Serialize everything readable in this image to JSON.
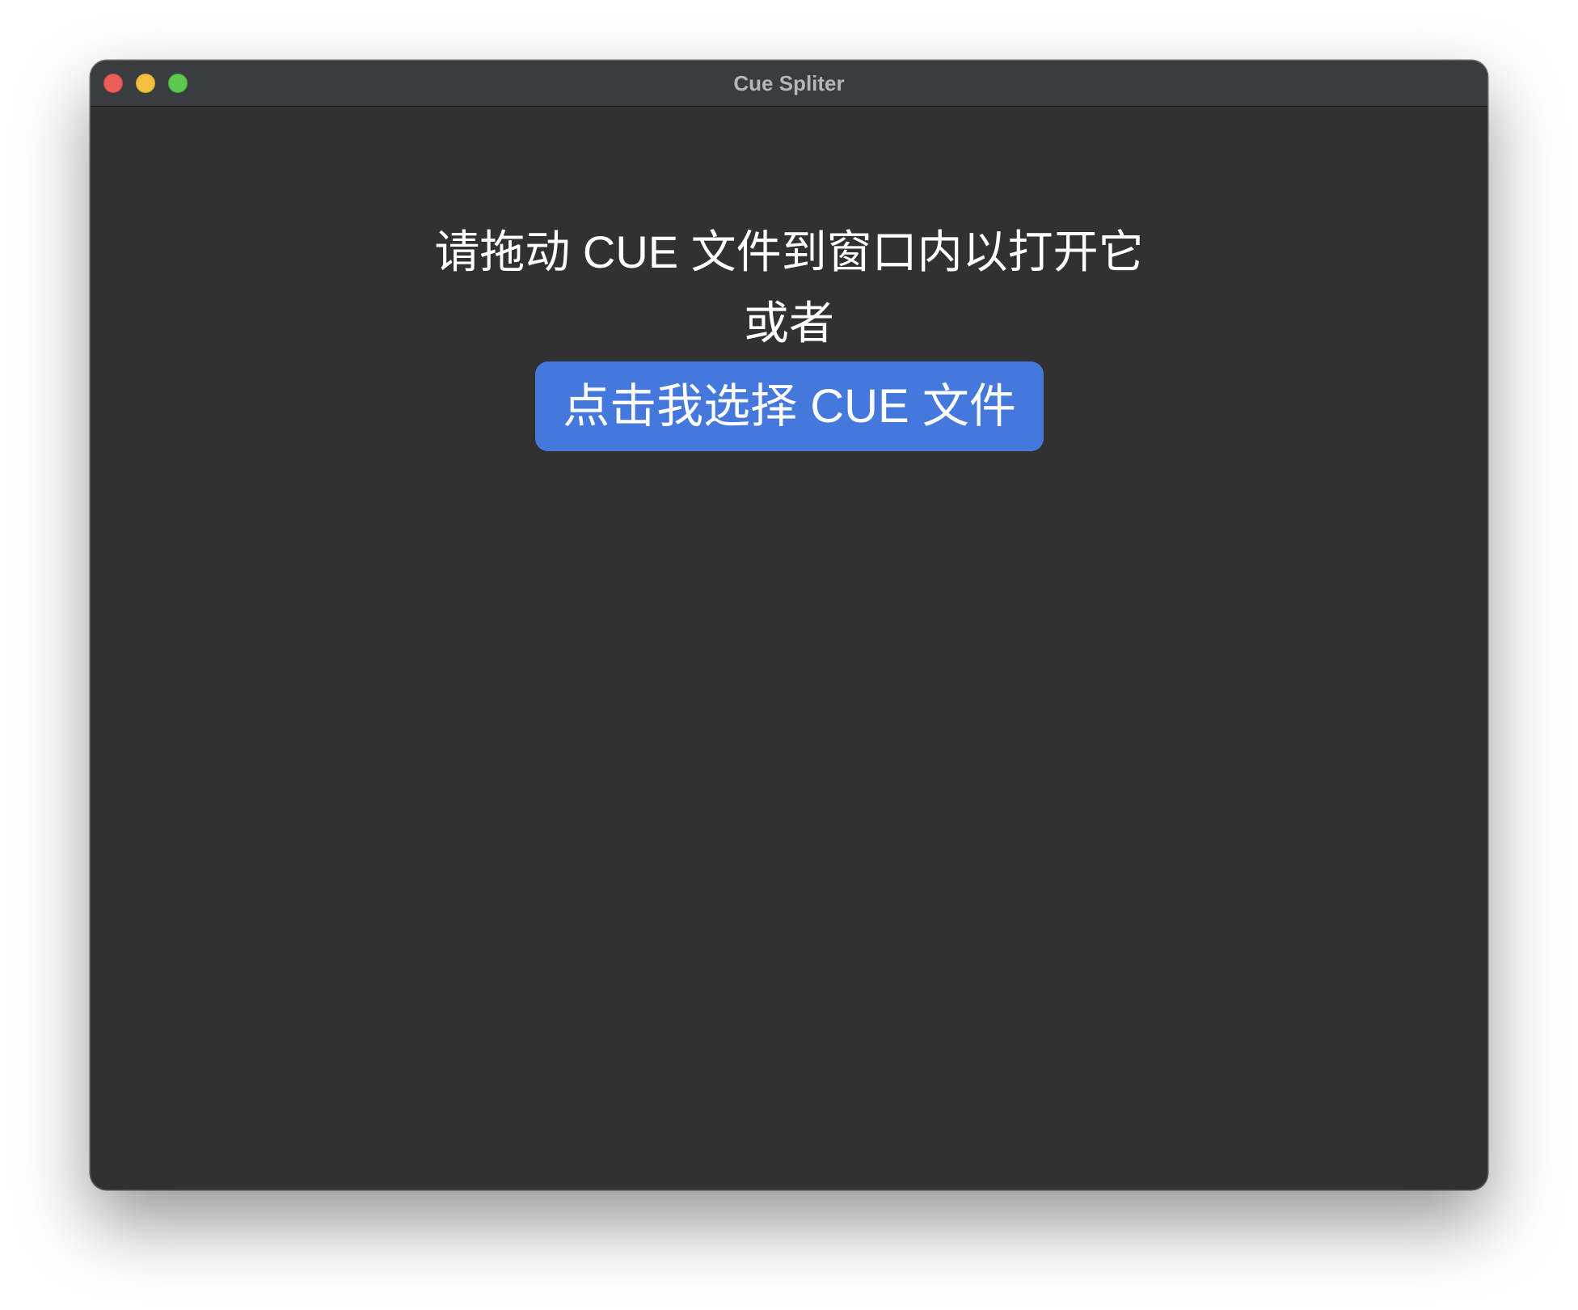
{
  "window": {
    "title": "Cue Spliter",
    "controls": {
      "close": "close-button",
      "minimize": "minimize-button",
      "zoom": "zoom-button"
    }
  },
  "main": {
    "instruction": "请拖动 CUE 文件到窗口内以打开它",
    "or_text": "或者",
    "choose_button_label": "点击我选择 CUE 文件"
  },
  "colors": {
    "window_background": "#313131",
    "titlebar_background": "#3a3d40",
    "button_accent": "#4478dc",
    "close": "#ec5f58",
    "minimize": "#f4be3e",
    "zoom": "#5ec84e"
  }
}
